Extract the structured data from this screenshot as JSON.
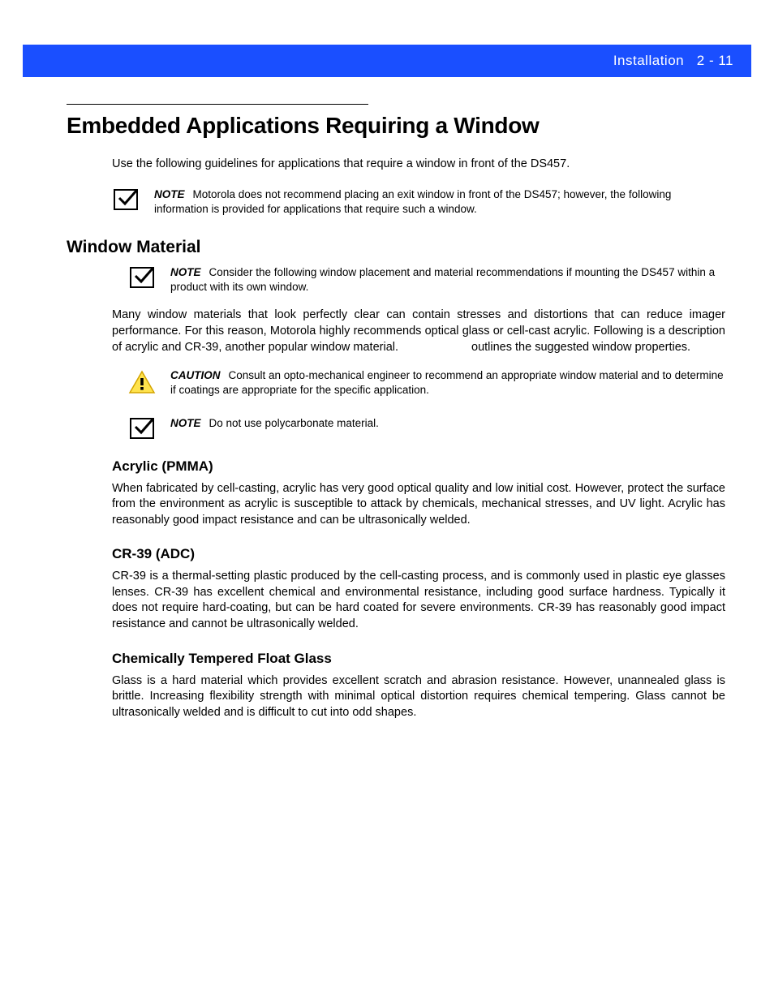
{
  "header": {
    "section": "Installation",
    "page": "2 - 11"
  },
  "h1": "Embedded Applications Requiring a Window",
  "intro": "Use the following guidelines for applications that require a window in front of the DS457.",
  "note1": {
    "label": "NOTE",
    "text": "Motorola does not recommend placing an exit window in front of the DS457; however, the following information is provided for applications that require such a window."
  },
  "h2_window_material": "Window Material",
  "note2": {
    "label": "NOTE",
    "text": "Consider the following window placement and material recommendations if mounting the DS457 within a product with its own window."
  },
  "para_materials_a": "Many window materials that look perfectly clear can contain stresses and distortions that can reduce imager performance. For this reason, Motorola highly recommends optical glass or cell-cast acrylic. Following is a description of acrylic and CR-39, another popular window material.",
  "para_materials_b": "outlines the suggested window properties.",
  "caution": {
    "label": "CAUTION",
    "text": "Consult an opto-mechanical engineer to recommend an appropriate window material and to determine if coatings are appropriate for the specific application."
  },
  "note3": {
    "label": "NOTE",
    "text": "Do not use polycarbonate material."
  },
  "acrylic": {
    "heading": "Acrylic (PMMA)",
    "text": "When fabricated by cell-casting, acrylic has very good optical quality and low initial cost. However, protect the surface from the environment as acrylic is susceptible to attack by chemicals, mechanical stresses, and UV light. Acrylic has reasonably good impact resistance and can be ultrasonically welded."
  },
  "cr39": {
    "heading": "CR-39 (ADC)",
    "text": "CR-39 is a thermal-setting plastic produced by the cell-casting process, and is commonly used in plastic eye glasses lenses. CR-39 has excellent chemical and environmental resistance, including good surface hardness. Typically it does not require hard-coating, but can be hard coated for severe environments. CR-39 has reasonably good impact resistance and cannot be ultrasonically welded."
  },
  "glass": {
    "heading": "Chemically Tempered Float Glass",
    "text": "Glass is a hard material which provides excellent scratch and abrasion resistance. However, unannealed glass is brittle. Increasing flexibility strength with minimal optical distortion requires chemical tempering. Glass cannot be ultrasonically welded and is difficult to cut into odd shapes."
  }
}
